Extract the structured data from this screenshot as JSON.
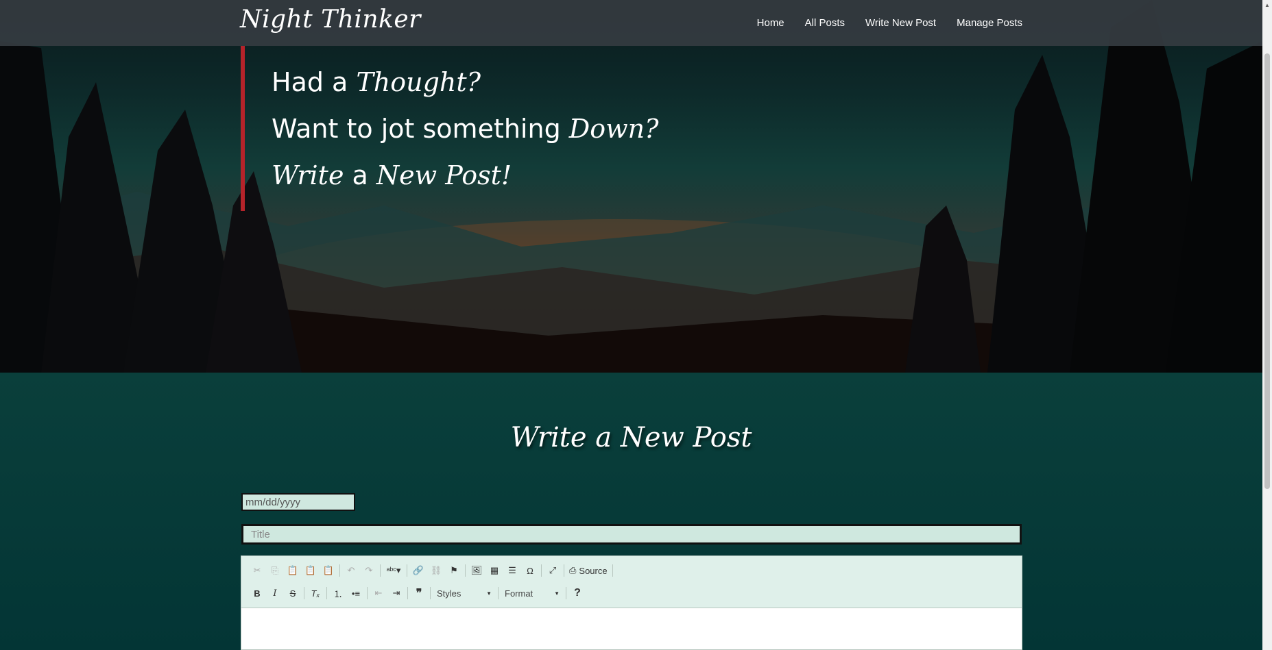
{
  "brand": "Night Thinker",
  "nav": [
    "Home",
    "All Posts",
    "Write New Post",
    "Manage Posts"
  ],
  "hero": {
    "line1_plain": "Had a ",
    "line1_em": "Thought?",
    "line2_plain": "Want to jot something ",
    "line2_em": "Down?",
    "line3_em1": "Write",
    "line3_plain": " a ",
    "line3_em2": "New Post!"
  },
  "form": {
    "heading": "Write a New Post",
    "date_placeholder": "mm/dd/yyyy",
    "title_placeholder": "Title"
  },
  "editor": {
    "source_label": "Source",
    "styles_label": "Styles",
    "format_label": "Format",
    "help_label": "?"
  },
  "colors": {
    "accent_bar": "#b5232a",
    "navbar": "#343a40",
    "section_bg": "#06332f",
    "input_bg": "#cfe8df"
  }
}
